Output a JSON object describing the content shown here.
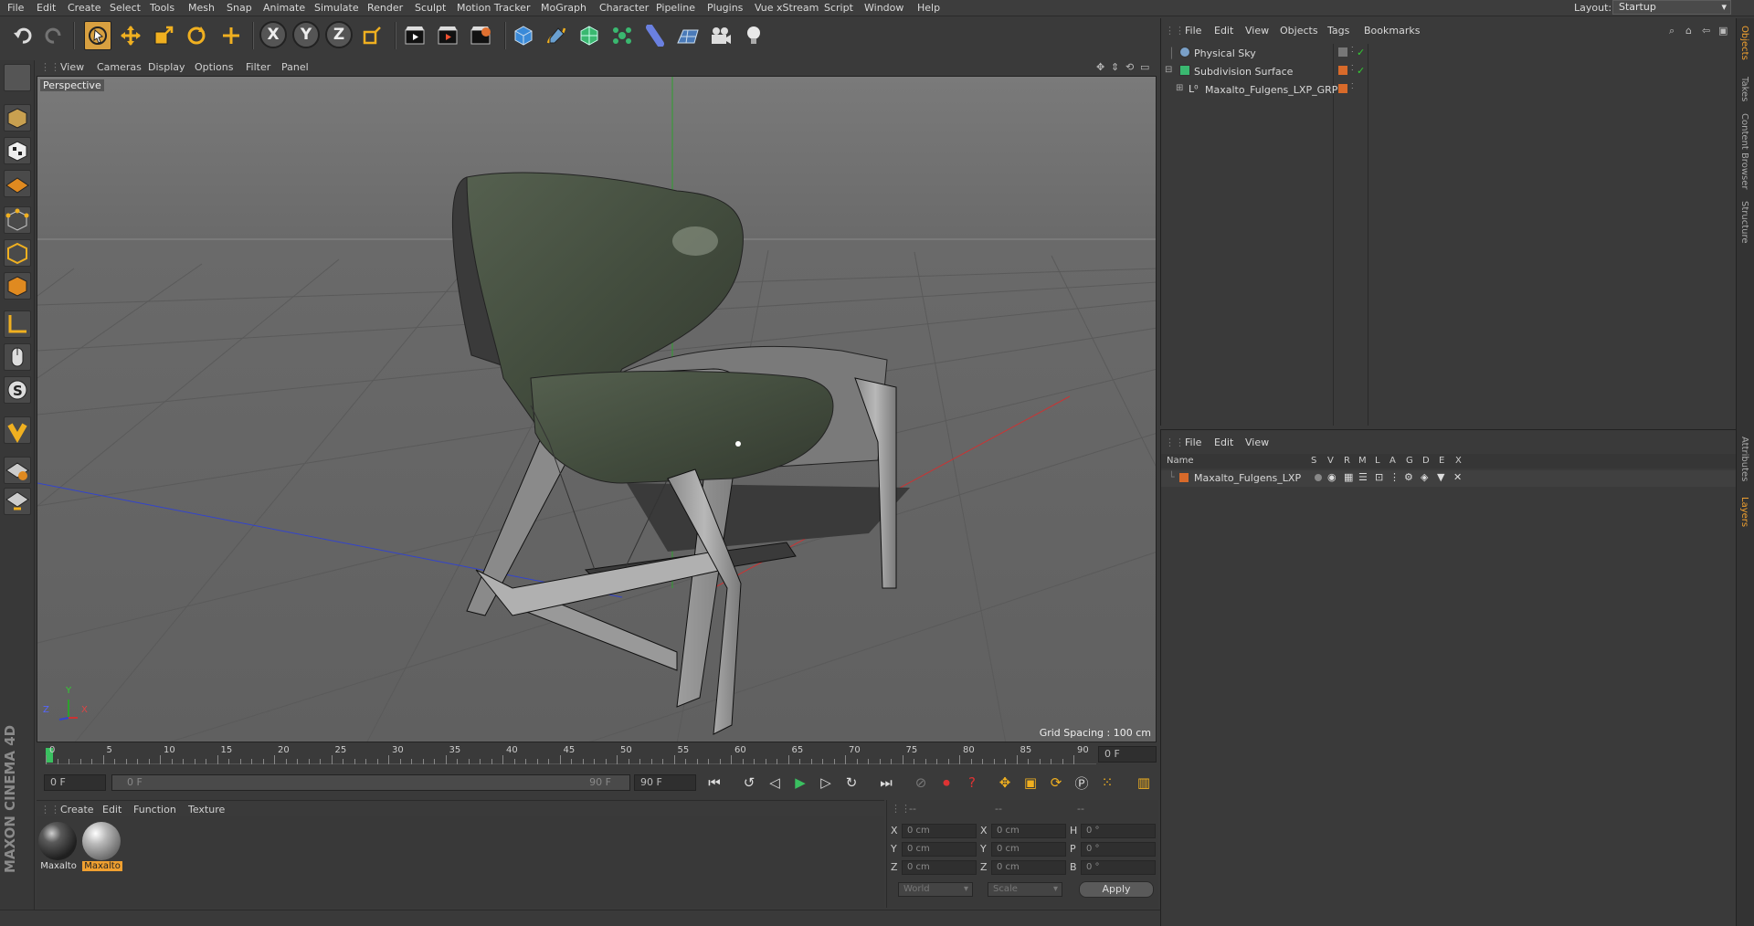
{
  "menubar": {
    "items": [
      "File",
      "Edit",
      "Create",
      "Select",
      "Tools",
      "Mesh",
      "Snap",
      "Animate",
      "Simulate",
      "Render",
      "Sculpt",
      "Motion Tracker",
      "MoGraph",
      "Character",
      "Pipeline",
      "Plugins",
      "Vue xStream",
      "Script",
      "Window",
      "Help"
    ],
    "layout_label": "Layout:",
    "layout_value": "Startup"
  },
  "toolbar": {
    "icons": [
      "undo-icon",
      "redo-icon",
      "live-selection-icon",
      "move-icon",
      "scale-icon",
      "rotate-icon",
      "last-tool-icon",
      "x-axis-lock-icon",
      "y-axis-lock-icon",
      "z-axis-lock-icon",
      "coordinate-system-icon",
      "render-view-icon",
      "render-picture-viewer-icon",
      "edit-render-settings-icon",
      "cube-icon",
      "pen-spline-icon",
      "subdivision-surface-icon",
      "cloner-icon",
      "deformer-icon",
      "floor-icon",
      "camera-icon",
      "light-icon"
    ],
    "axis_labels": [
      "X",
      "Y",
      "Z"
    ]
  },
  "left_tools": [
    "make-editable-icon",
    "model-mode-icon",
    "texture-mode-icon",
    "workplane-icon",
    "points-mode-icon",
    "edges-mode-icon",
    "polygons-mode-icon",
    "axis-mode-icon",
    "tweak-mode-icon",
    "solo-icon",
    "snap-icon",
    "workplane-lock-icon",
    "grid-snap-icon"
  ],
  "branding": "MAXON CINEMA 4D",
  "viewport": {
    "menu": [
      "View",
      "Cameras",
      "Display",
      "Options",
      "Filter",
      "Panel"
    ],
    "label": "Perspective",
    "grid_spacing": "Grid Spacing : 100 cm",
    "axis_labels": {
      "y": "Y",
      "z": "Z",
      "x": "X"
    }
  },
  "timeline": {
    "ticks": [
      "0",
      "5",
      "10",
      "15",
      "20",
      "25",
      "30",
      "35",
      "40",
      "45",
      "50",
      "55",
      "60",
      "65",
      "70",
      "75",
      "80",
      "85",
      "90"
    ],
    "current_frame": "0 F",
    "start_field": "0 F",
    "range_start": "0 F",
    "range_end": "90 F",
    "end_field": "90 F"
  },
  "materials": {
    "menu": [
      "Create",
      "Edit",
      "Function",
      "Texture"
    ],
    "items": [
      {
        "label": "Maxalto",
        "selected": false,
        "color": "#3a3a3a"
      },
      {
        "label": "Maxalto",
        "selected": true,
        "color": "#9a9a9a"
      }
    ]
  },
  "coordinates": {
    "headers": [
      "--",
      "--",
      "--"
    ],
    "rows": [
      {
        "pos_label": "X",
        "pos": "0 cm",
        "size_label": "X",
        "size": "0 cm",
        "rot_label": "H",
        "rot": "0 °"
      },
      {
        "pos_label": "Y",
        "pos": "0 cm",
        "size_label": "Y",
        "size": "0 cm",
        "rot_label": "P",
        "rot": "0 °"
      },
      {
        "pos_label": "Z",
        "pos": "0 cm",
        "size_label": "Z",
        "size": "0 cm",
        "rot_label": "B",
        "rot": "0 °"
      }
    ],
    "mode": "World",
    "size_mode": "Scale",
    "apply": "Apply"
  },
  "objects": {
    "menu": [
      "File",
      "Edit",
      "View",
      "Objects",
      "Tags",
      "Bookmarks"
    ],
    "items": [
      {
        "name": "Physical Sky",
        "indent": 0
      },
      {
        "name": "Subdivision Surface",
        "indent": 0
      },
      {
        "name": "Maxalto_Fulgens_LXP_GRP",
        "indent": 1
      }
    ]
  },
  "layers": {
    "menu": [
      "File",
      "Edit",
      "View"
    ],
    "columns": [
      "Name",
      "S",
      "V",
      "R",
      "M",
      "L",
      "A",
      "G",
      "D",
      "E",
      "X"
    ],
    "items": [
      {
        "name": "Maxalto_Fulgens_LXP",
        "color": "#d86a2a"
      }
    ]
  },
  "right_tabs": [
    "Objects",
    "Takes",
    "Content Browser",
    "Structure",
    "Attributes",
    "Layers"
  ],
  "colors": {
    "accent": "#f0a030",
    "layer_orange": "#d86a2a",
    "axis_x": "#cc3333",
    "axis_y": "#33aa33",
    "axis_z": "#3344cc"
  }
}
